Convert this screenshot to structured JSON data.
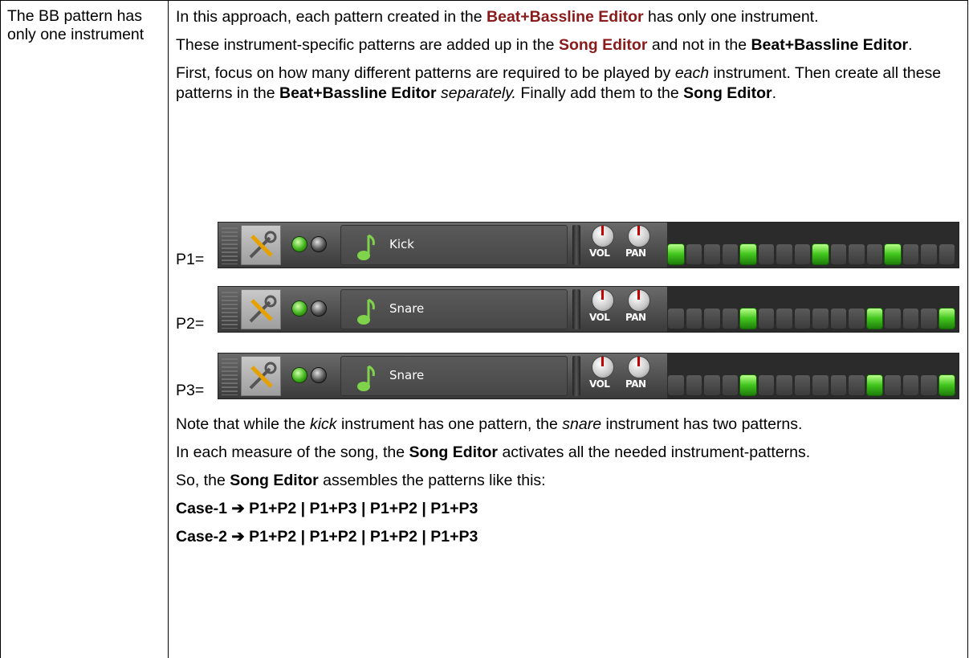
{
  "left_cell": {
    "text": "The BB pattern has only one instrument"
  },
  "intro": {
    "p1_a": "In this approach, each pattern created in the ",
    "p1_b": "Beat+Bassline Editor",
    "p1_c": " has only one instrument.",
    "p2_a": "These instrument-specific patterns are added up in the ",
    "p2_b": "Song Editor",
    "p2_c": " and not in the ",
    "p2_d": "Beat+Bassline Editor",
    "p2_e": ".",
    "p3_a": "First, focus on how many different patterns are required to be played by ",
    "p3_b": "each",
    "p3_c": " instrument. Then create all these patterns in the ",
    "p3_d": "Beat+Bassline Editor",
    "p3_e": " ",
    "p3_f": "separately.",
    "p3_g": " Finally add them to the ",
    "p3_h": "Song Editor",
    "p3_i": "."
  },
  "patterns": [
    {
      "label": "P1=",
      "instrument": "Kick",
      "vol_label": "VOL",
      "pan_label": "PAN",
      "steps": [
        1,
        0,
        0,
        0,
        1,
        0,
        0,
        0,
        1,
        0,
        0,
        0,
        1,
        0,
        0,
        0
      ]
    },
    {
      "label": "P2=",
      "instrument": "Snare",
      "vol_label": "VOL",
      "pan_label": "PAN",
      "steps": [
        0,
        0,
        0,
        0,
        1,
        0,
        0,
        0,
        0,
        0,
        0,
        1,
        0,
        0,
        0,
        1
      ]
    },
    {
      "label": "P3=",
      "instrument": "Snare",
      "vol_label": "VOL",
      "pan_label": "PAN",
      "steps": [
        0,
        0,
        0,
        0,
        1,
        0,
        0,
        0,
        0,
        0,
        0,
        1,
        0,
        0,
        0,
        1
      ]
    }
  ],
  "outro": {
    "note_a": "Note that while the ",
    "note_b": "kick",
    "note_c": " instrument has one pattern, the ",
    "note_d": "snare",
    "note_e": " instrument has two patterns.",
    "measure_a": "In each measure of the song, the ",
    "measure_b": "Song Editor",
    "measure_c": " activates all the needed instrument-patterns.",
    "so_a": "So, the ",
    "so_b": "Song Editor",
    "so_c": " assembles the patterns like this:",
    "case1": "Case-1 ➔ P1+P2 | P1+P3 | P1+P2 | P1+P3",
    "case2": "Case-2 ➔ P1+P2 | P1+P2 | P1+P2 | P1+P3"
  },
  "colors": {
    "accent_red": "#8b1a1a",
    "step_on": "#41c51c"
  },
  "icons": [
    "tool-icon",
    "music-note-icon",
    "green-led-icon",
    "mute-led-icon",
    "volume-knob-icon",
    "pan-knob-icon"
  ]
}
